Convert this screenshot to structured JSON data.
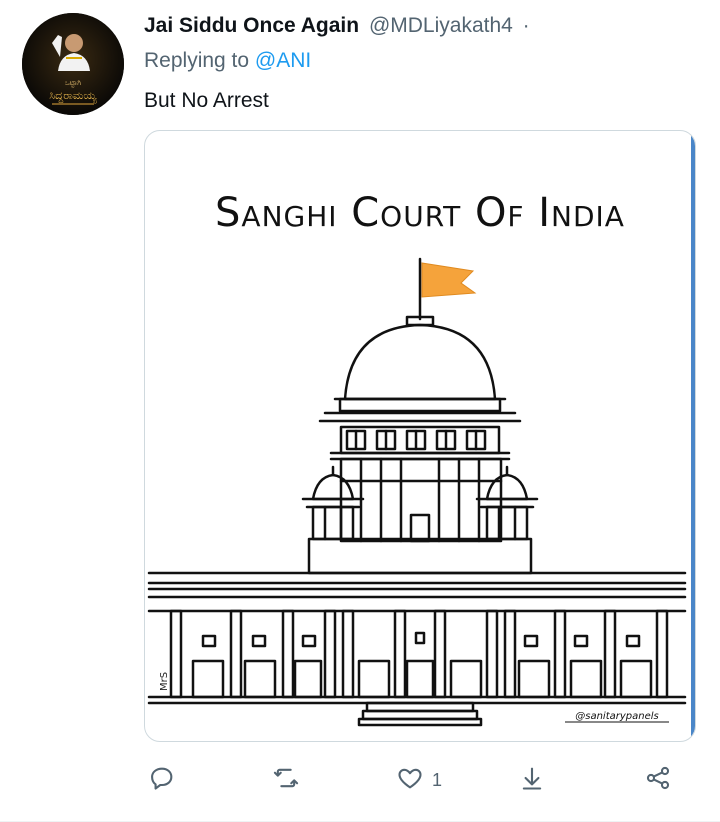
{
  "tweet": {
    "display_name": "Jai Siddu Once Again",
    "handle": "@MDLiyakath4",
    "separator": "·",
    "replying_prefix": "Replying to",
    "replying_to": "@ANI",
    "text": "But No Arrest"
  },
  "avatar": {
    "caption": "ಸಿದ್ದರಾಮಯ್ಯ"
  },
  "media": {
    "heading": "Sanghi Court Of India",
    "signature": "@sanitarypanels",
    "side_signature": "MrS",
    "flag_color": "#f5a33b",
    "accent_edge": "#4a86c8"
  },
  "actions": {
    "reply_icon": "reply-icon",
    "retweet_icon": "retweet-icon",
    "like_icon": "heart-icon",
    "like_count": "1",
    "download_icon": "download-icon",
    "share_icon": "share-icon"
  },
  "colors": {
    "text": "#0f1419",
    "secondary": "#536471",
    "link": "#1d9bf0"
  }
}
